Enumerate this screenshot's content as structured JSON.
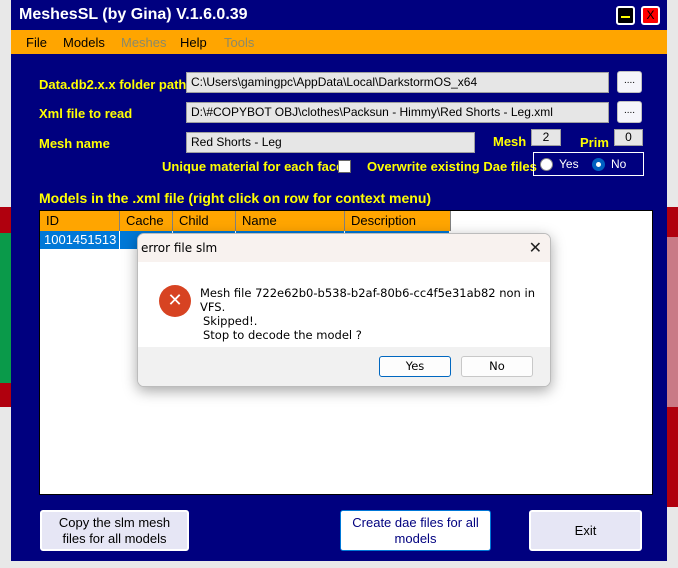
{
  "window": {
    "title": "MeshesSL (by Gina) V.1.6.0.39",
    "minimize_glyph": "—",
    "close_glyph": "X"
  },
  "menu": [
    {
      "label": "File",
      "enabled": true
    },
    {
      "label": "Models",
      "enabled": true
    },
    {
      "label": "Meshes",
      "enabled": false
    },
    {
      "label": "Help",
      "enabled": true
    },
    {
      "label": "Tools",
      "enabled": false
    }
  ],
  "form": {
    "data_folder_label": "Data.db2.x.x folder path",
    "data_folder_value": "C:\\Users\\gamingpc\\AppData\\Local\\DarkstormOS_x64",
    "xml_file_label": "Xml file to read",
    "xml_file_value": "D:\\#COPYBOT OBJ\\clothes\\Packsun - Himmy\\Red Shorts - Leg.xml",
    "browse_label": "....",
    "mesh_name_label": "Mesh name",
    "mesh_name_value": "Red Shorts - Leg",
    "mesh_label": "Mesh",
    "mesh_value": "2",
    "prim_label": "Prim",
    "prim_value": "0",
    "unique_material_label": "Unique material for each face",
    "unique_material_checked": false,
    "overwrite_label": "Overwrite existing Dae files",
    "overwrite_options": [
      "Yes",
      "No"
    ],
    "overwrite_selected": "No"
  },
  "models": {
    "heading": "Models in the .xml file (right click on row for context menu)",
    "columns": [
      "ID",
      "Cache",
      "Child",
      "Name",
      "Description"
    ],
    "rows": [
      [
        "1001451513",
        "",
        "",
        "",
        ""
      ]
    ]
  },
  "buttons": {
    "copy_slm_line1": "Copy the slm mesh",
    "copy_slm_line2": "files  for all models",
    "create_dae_line1": "Create dae files for all",
    "create_dae_line2": "models",
    "exit": "Exit"
  },
  "dialog": {
    "title": "error file slm",
    "close_glyph": "✕",
    "icon_glyph": "✕",
    "message_line1": "Mesh file 722e62b0-b538-b2af-80b6-cc4f5e31ab82 non in VFS.",
    "message_line2": "Skipped!.",
    "message_line3": "Stop to decode the model ?",
    "yes_label": "Yes",
    "no_label": "No"
  }
}
